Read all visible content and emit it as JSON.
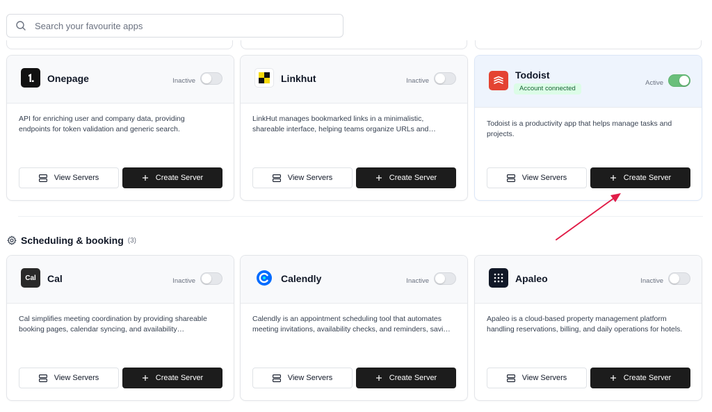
{
  "search": {
    "placeholder": "Search your favourite apps"
  },
  "cards_row1": [
    {
      "name": "Onepage",
      "status": "Inactive",
      "active": false,
      "description": "API for enriching user and company data, providing endpoints for token validation and generic search.",
      "view_label": "View Servers",
      "create_label": "Create Server",
      "logo_icon": "onepage-logo"
    },
    {
      "name": "Linkhut",
      "status": "Inactive",
      "active": false,
      "description": "LinkHut manages bookmarked links in a minimalistic, shareable interface, helping teams organize URLs and tracking usage.",
      "view_label": "View Servers",
      "create_label": "Create Server",
      "logo_icon": "linkhut-logo"
    },
    {
      "name": "Todoist",
      "status": "Active",
      "active": true,
      "badge": "Account connected",
      "description": "Todoist is a productivity app that helps manage tasks and projects.",
      "view_label": "View Servers",
      "create_label": "Create Server",
      "logo_icon": "todoist-logo"
    }
  ],
  "section": {
    "title": "Scheduling & booking",
    "count": "(3)",
    "icon": "gear-icon"
  },
  "cards_row2": [
    {
      "name": "Cal",
      "logo_text": "Cal",
      "status": "Inactive",
      "active": false,
      "description": "Cal simplifies meeting coordination by providing shareable booking pages, calendar syncing, and availability management.",
      "view_label": "View Servers",
      "create_label": "Create Server",
      "logo_icon": "cal-logo"
    },
    {
      "name": "Calendly",
      "status": "Inactive",
      "active": false,
      "description": "Calendly is an appointment scheduling tool that automates meeting invitations, availability checks, and reminders, saving time.",
      "view_label": "View Servers",
      "create_label": "Create Server",
      "logo_icon": "calendly-logo"
    },
    {
      "name": "Apaleo",
      "status": "Inactive",
      "active": false,
      "description": "Apaleo is a cloud-based property management platform handling reservations, billing, and daily operations for hotels.",
      "view_label": "View Servers",
      "create_label": "Create Server",
      "logo_icon": "apaleo-logo"
    }
  ],
  "colors": {
    "accent_dark": "#1c1c1c",
    "toggle_on": "#6abf7b",
    "badge_bg": "#dcfce7",
    "annotation_arrow": "#e11d48"
  }
}
